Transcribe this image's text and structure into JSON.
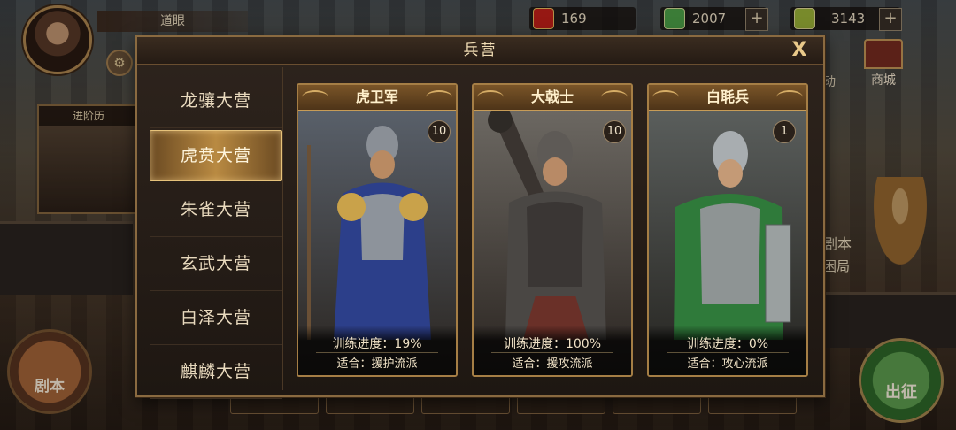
{
  "player": {
    "name": "道眼"
  },
  "currencies": [
    {
      "id": "token",
      "value": "169",
      "color": "#c8201a"
    },
    {
      "id": "jade",
      "value": "2007",
      "color": "#4fa64a"
    },
    {
      "id": "gold-jade",
      "value": "3143",
      "color": "#a0b83a"
    }
  ],
  "left_widget": {
    "title": "进阶历"
  },
  "side": {
    "shop_label": "商城",
    "juben_label": "剧本",
    "chuzheng_label": "出征",
    "story_label": "剧本",
    "story_sub": "困局",
    "partial_label": "动"
  },
  "modal": {
    "title": "兵营",
    "close": "X",
    "tabs": [
      {
        "label": "龙骧大营",
        "active": false
      },
      {
        "label": "虎贲大营",
        "active": true
      },
      {
        "label": "朱雀大营",
        "active": false
      },
      {
        "label": "玄武大营",
        "active": false
      },
      {
        "label": "白泽大营",
        "active": false
      },
      {
        "label": "麒麟大营",
        "active": false
      }
    ],
    "cards": [
      {
        "name": "虎卫军",
        "level": "10",
        "progress": "训练进度：19%",
        "fit": "适合：援护流派",
        "progress_value": 19,
        "armor_color": "#2c3f8a",
        "accent": "#c9a24a"
      },
      {
        "name": "大戟士",
        "level": "10",
        "progress": "训练进度：100%",
        "fit": "适合：援攻流派",
        "progress_value": 100,
        "armor_color": "#4a4744",
        "accent": "#8a6a48"
      },
      {
        "name": "白毦兵",
        "level": "1",
        "progress": "训练进度：0%",
        "fit": "适合：攻心流派",
        "progress_value": 0,
        "armor_color": "#2f7a3a",
        "accent": "#9aa0a0"
      }
    ]
  }
}
